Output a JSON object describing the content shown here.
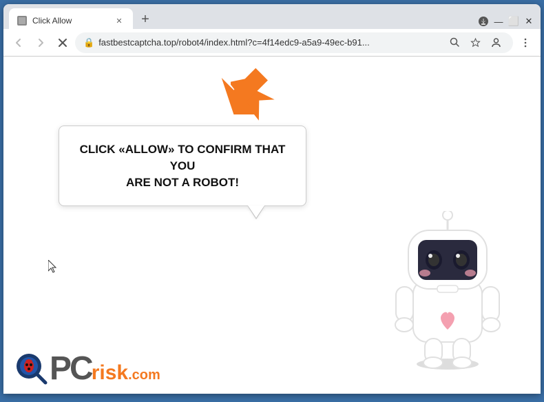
{
  "browser": {
    "tab": {
      "title": "Click Allow",
      "favicon_label": "tab-favicon"
    },
    "new_tab_label": "+",
    "window_controls": {
      "minimize": "—",
      "maximize": "⬜",
      "close": "✕"
    },
    "nav": {
      "back": "←",
      "forward": "→",
      "reload": "✕"
    },
    "address": "fastbestcaptcha.top/robot4/index.html?c=4f14edc9-a5a9-49ec-b91...",
    "address_icons": {
      "search": "🔍",
      "bookmark": "☆",
      "profile": "👤",
      "menu": "⋮"
    },
    "download_icon": "⬇"
  },
  "page": {
    "bubble_text_line1": "CLICK «ALLOW» TO CONFIRM THAT YOU",
    "bubble_text_line2": "ARE NOT A ROBOT!",
    "logo": {
      "pc": "PC",
      "risk": "risk",
      "com": ".com"
    }
  }
}
